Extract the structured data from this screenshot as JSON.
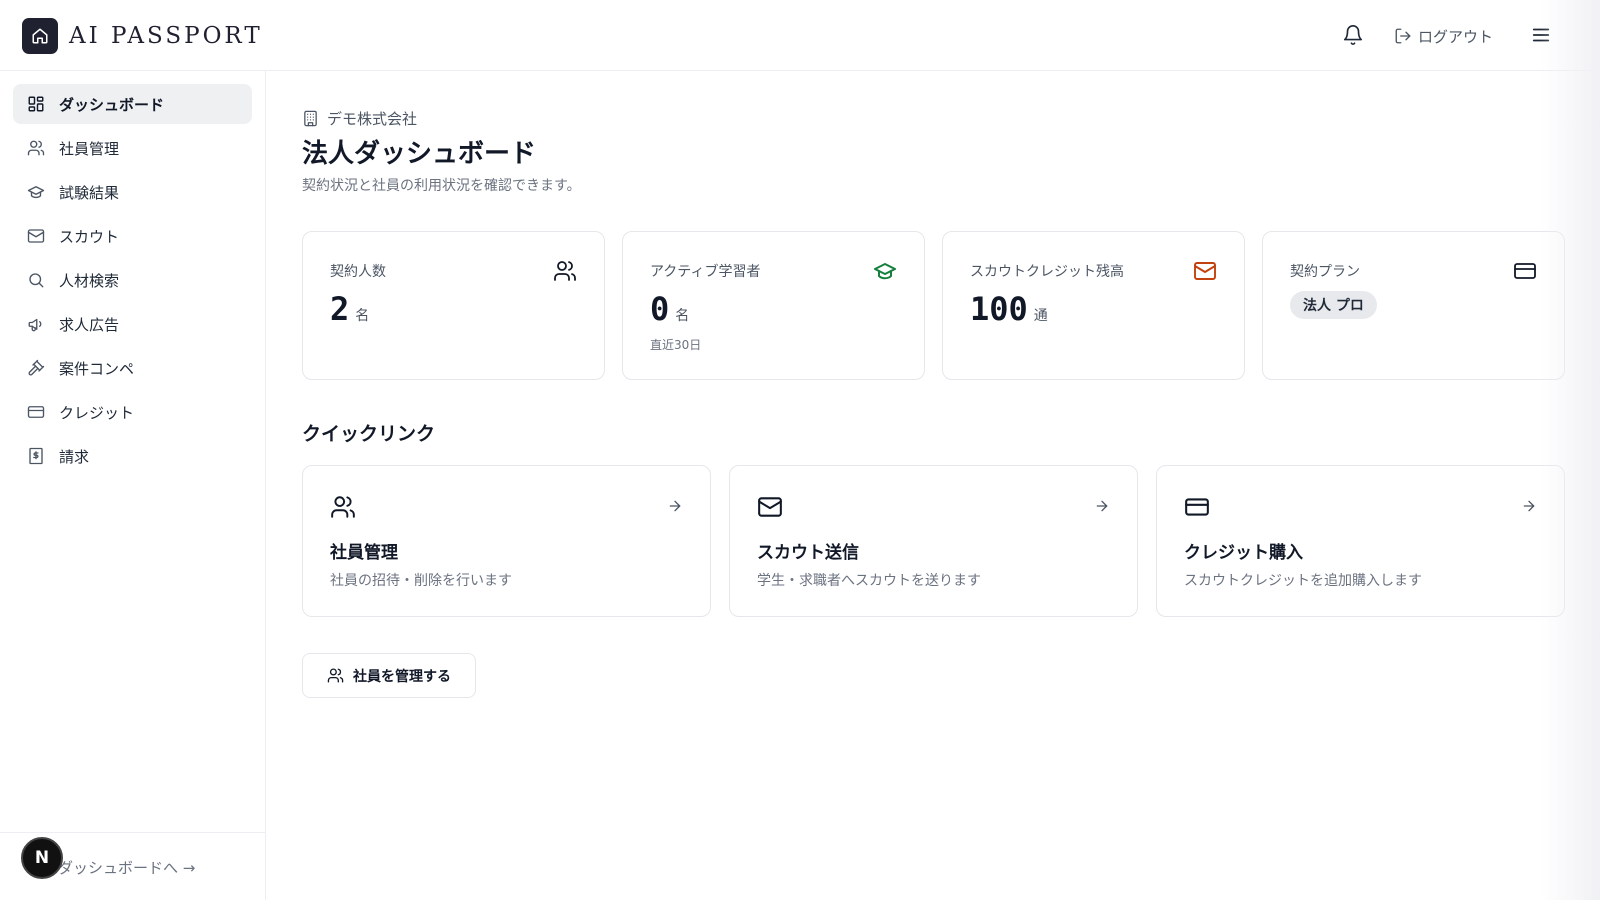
{
  "header": {
    "logo_text": "AI PASSPORT",
    "logout_label": "ログアウト"
  },
  "sidebar": {
    "items": [
      {
        "label": "ダッシュボード",
        "icon": "layout-grid-icon",
        "active": true
      },
      {
        "label": "社員管理",
        "icon": "users-icon"
      },
      {
        "label": "試験結果",
        "icon": "graduation-cap-icon"
      },
      {
        "label": "スカウト",
        "icon": "mail-icon"
      },
      {
        "label": "人材検索",
        "icon": "search-icon"
      },
      {
        "label": "求人広告",
        "icon": "megaphone-icon"
      },
      {
        "label": "案件コンペ",
        "icon": "gavel-icon"
      },
      {
        "label": "クレジット",
        "icon": "credit-card-icon"
      },
      {
        "label": "請求",
        "icon": "receipt-icon"
      }
    ],
    "footer_link": "ダッシュボードへ →",
    "badge_letter": "N"
  },
  "main": {
    "company": "デモ株式会社",
    "title": "法人ダッシュボード",
    "subtitle": "契約状況と社員の利用状況を確認できます。",
    "stats": [
      {
        "label": "契約人数",
        "value": "2",
        "unit": "名",
        "icon": "users-icon"
      },
      {
        "label": "アクティブ学習者",
        "value": "0",
        "unit": "名",
        "note": "直近30日",
        "icon": "graduation-cap-icon",
        "icon_color": "#15803d"
      },
      {
        "label": "スカウトクレジット残高",
        "value": "100",
        "unit": "通",
        "icon": "mail-icon",
        "icon_color": "#c2410c"
      },
      {
        "label": "契約プラン",
        "badge": "法人 プロ",
        "icon": "credit-card-icon"
      }
    ],
    "quick_links_title": "クイックリンク",
    "quick_links": [
      {
        "title": "社員管理",
        "desc": "社員の招待・削除を行います",
        "icon": "users-icon"
      },
      {
        "title": "スカウト送信",
        "desc": "学生・求職者へスカウトを送ります",
        "icon": "mail-icon"
      },
      {
        "title": "クレジット購入",
        "desc": "スカウトクレジットを追加購入します",
        "icon": "credit-card-icon"
      }
    ],
    "manage_button": "社員を管理する"
  }
}
